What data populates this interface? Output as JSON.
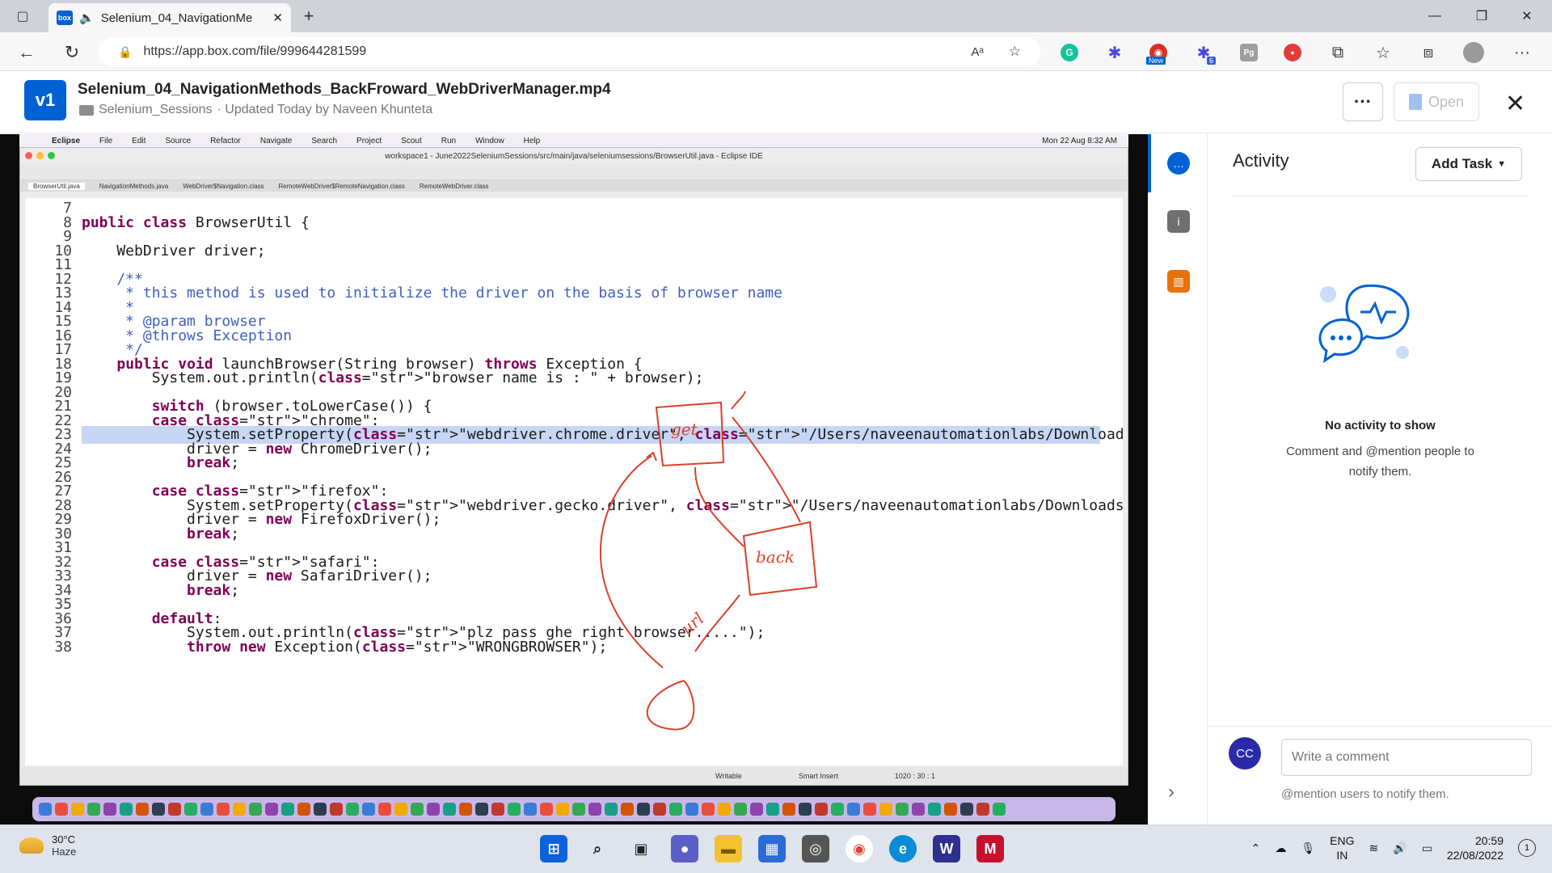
{
  "browser": {
    "tab_title": "Selenium_04_NavigationMe",
    "url": "https://app.box.com/file/999644281599",
    "extensions": [
      {
        "name": "grammarly-icon",
        "color": "#15c39a",
        "glyph": "G"
      },
      {
        "name": "sparkle-icon",
        "color": "#4a46e0",
        "glyph": "✱"
      },
      {
        "name": "new-extension-icon",
        "color": "#d93025",
        "glyph": "◉"
      },
      {
        "name": "sparkle-badge-icon",
        "color": "#4a46e0",
        "glyph": "✱"
      },
      {
        "name": "pg-icon",
        "color": "#9e9e9e",
        "glyph": "Pg"
      },
      {
        "name": "record-icon",
        "color": "#e33b3b",
        "glyph": "●"
      }
    ],
    "new_badge": "New",
    "ext_badge": "6"
  },
  "file": {
    "version_badge": "v1",
    "name": "Selenium_04_NavigationMethods_BackFroward_WebDriverManager.mp4",
    "folder": "Selenium_Sessions",
    "updated": "· Updated Today by Naveen Khunteta",
    "more_label": "···",
    "open_label": "Open"
  },
  "video": {
    "mac_menu": [
      "Eclipse",
      "File",
      "Edit",
      "Source",
      "Refactor",
      "Navigate",
      "Search",
      "Project",
      "Scout",
      "Run",
      "Window",
      "Help"
    ],
    "mac_clock": "Mon 22 Aug 8:32 AM",
    "window_title": "workspace1 - June2022SeleniumSessions/src/main/java/seleniumsessions/BrowserUtil.java - Eclipse IDE",
    "editor_tabs": [
      "BrowserUtil.java",
      "NavigationMethods.java",
      "WebDriver$Navigation.class",
      "RemoteWebDriver$RemoteNavigation.class",
      "RemoteWebDriver.class"
    ],
    "status": [
      "Writable",
      "Smart Insert",
      "1020 : 30 : 1"
    ],
    "code": [
      {
        "n": "7",
        "t": ""
      },
      {
        "n": "8",
        "t": "public class BrowserUtil {"
      },
      {
        "n": "9",
        "t": ""
      },
      {
        "n": "10",
        "t": "    WebDriver driver;"
      },
      {
        "n": "11",
        "t": ""
      },
      {
        "n": "12",
        "t": "    /**"
      },
      {
        "n": "13",
        "t": "     * this method is used to initialize the driver on the basis of browser name"
      },
      {
        "n": "14",
        "t": "     *"
      },
      {
        "n": "15",
        "t": "     * @param browser"
      },
      {
        "n": "16",
        "t": "     * @throws Exception"
      },
      {
        "n": "17",
        "t": "     */"
      },
      {
        "n": "18",
        "t": "    public void launchBrowser(String browser) throws Exception {"
      },
      {
        "n": "19",
        "t": "        System.out.println(\"browser name is : \" + browser);"
      },
      {
        "n": "20",
        "t": ""
      },
      {
        "n": "21",
        "t": "        switch (browser.toLowerCase()) {"
      },
      {
        "n": "22",
        "t": "        case \"chrome\":"
      },
      {
        "n": "23",
        "t": "            System.setProperty(\"webdriver.chrome.driver\", \"/Users/naveenautomationlabs/Downloads/chromedriver\");"
      },
      {
        "n": "24",
        "t": "            driver = new ChromeDriver();"
      },
      {
        "n": "25",
        "t": "            break;"
      },
      {
        "n": "26",
        "t": ""
      },
      {
        "n": "27",
        "t": "        case \"firefox\":"
      },
      {
        "n": "28",
        "t": "            System.setProperty(\"webdriver.gecko.driver\", \"/Users/naveenautomationlabs/Downloads/geckodriver\");"
      },
      {
        "n": "29",
        "t": "            driver = new FirefoxDriver();"
      },
      {
        "n": "30",
        "t": "            break;"
      },
      {
        "n": "31",
        "t": ""
      },
      {
        "n": "32",
        "t": "        case \"safari\":"
      },
      {
        "n": "33",
        "t": "            driver = new SafariDriver();"
      },
      {
        "n": "34",
        "t": "            break;"
      },
      {
        "n": "35",
        "t": ""
      },
      {
        "n": "36",
        "t": "        default:"
      },
      {
        "n": "37",
        "t": "            System.out.println(\"plz pass ghe right browser.....\");"
      },
      {
        "n": "38",
        "t": "            throw new Exception(\"WRONGBROWSER\");"
      }
    ],
    "sketch_labels": [
      "get",
      "back",
      "url"
    ]
  },
  "activity": {
    "title": "Activity",
    "add_task": "Add Task",
    "empty_title": "No activity to show",
    "empty_body": "Comment and @mention people to notify them.",
    "avatar": "CC",
    "comment_placeholder": "Write a comment",
    "mention_hint": "@mention users to notify them."
  },
  "taskbar": {
    "temp": "30°C",
    "weather": "Haze",
    "lang1": "ENG",
    "lang2": "IN",
    "time": "20:59",
    "date": "22/08/2022",
    "notifications": "1"
  }
}
